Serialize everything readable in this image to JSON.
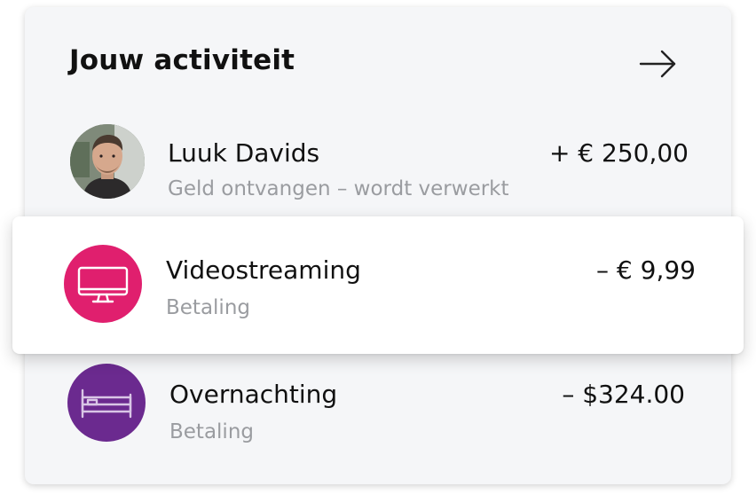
{
  "header": {
    "title": "Jouw activiteit"
  },
  "activities": [
    {
      "name": "Luuk Davids",
      "subtitle": "Geld ontvangen – wordt verwerkt",
      "amount": "+ € 250,00",
      "icon": "person-photo-avatar"
    },
    {
      "name": "Videostreaming",
      "subtitle": "Betaling",
      "amount": "– € 9,99",
      "icon": "monitor-icon",
      "icon_bg": "#e01f6e"
    },
    {
      "name": "Overnachting",
      "subtitle": "Betaling",
      "amount": "– $324.00",
      "icon": "bed-icon",
      "icon_bg": "#6b2a8f"
    }
  ]
}
